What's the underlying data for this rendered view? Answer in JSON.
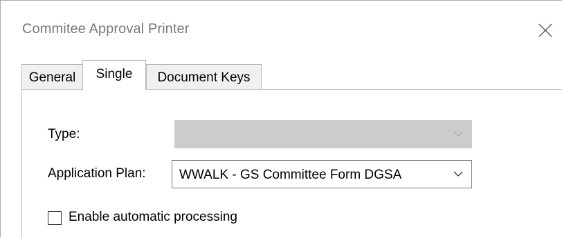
{
  "window": {
    "title": "Commitee Approval Printer",
    "close_icon": "close-icon"
  },
  "tabs": [
    {
      "label": "General",
      "active": false
    },
    {
      "label": "Single",
      "active": true
    },
    {
      "label": "Document Keys",
      "active": false
    }
  ],
  "form": {
    "type_label": "Type:",
    "type_value": "",
    "type_disabled": true,
    "plan_label": "Application Plan:",
    "plan_value": "WWALK - GS Committee Form DGSA",
    "auto_label": "Enable automatic processing",
    "auto_checked": false
  },
  "colors": {
    "disabled_combo": "#cccccc",
    "title_text": "#7a7a7a",
    "tab_inactive": "#f0f0f0"
  }
}
